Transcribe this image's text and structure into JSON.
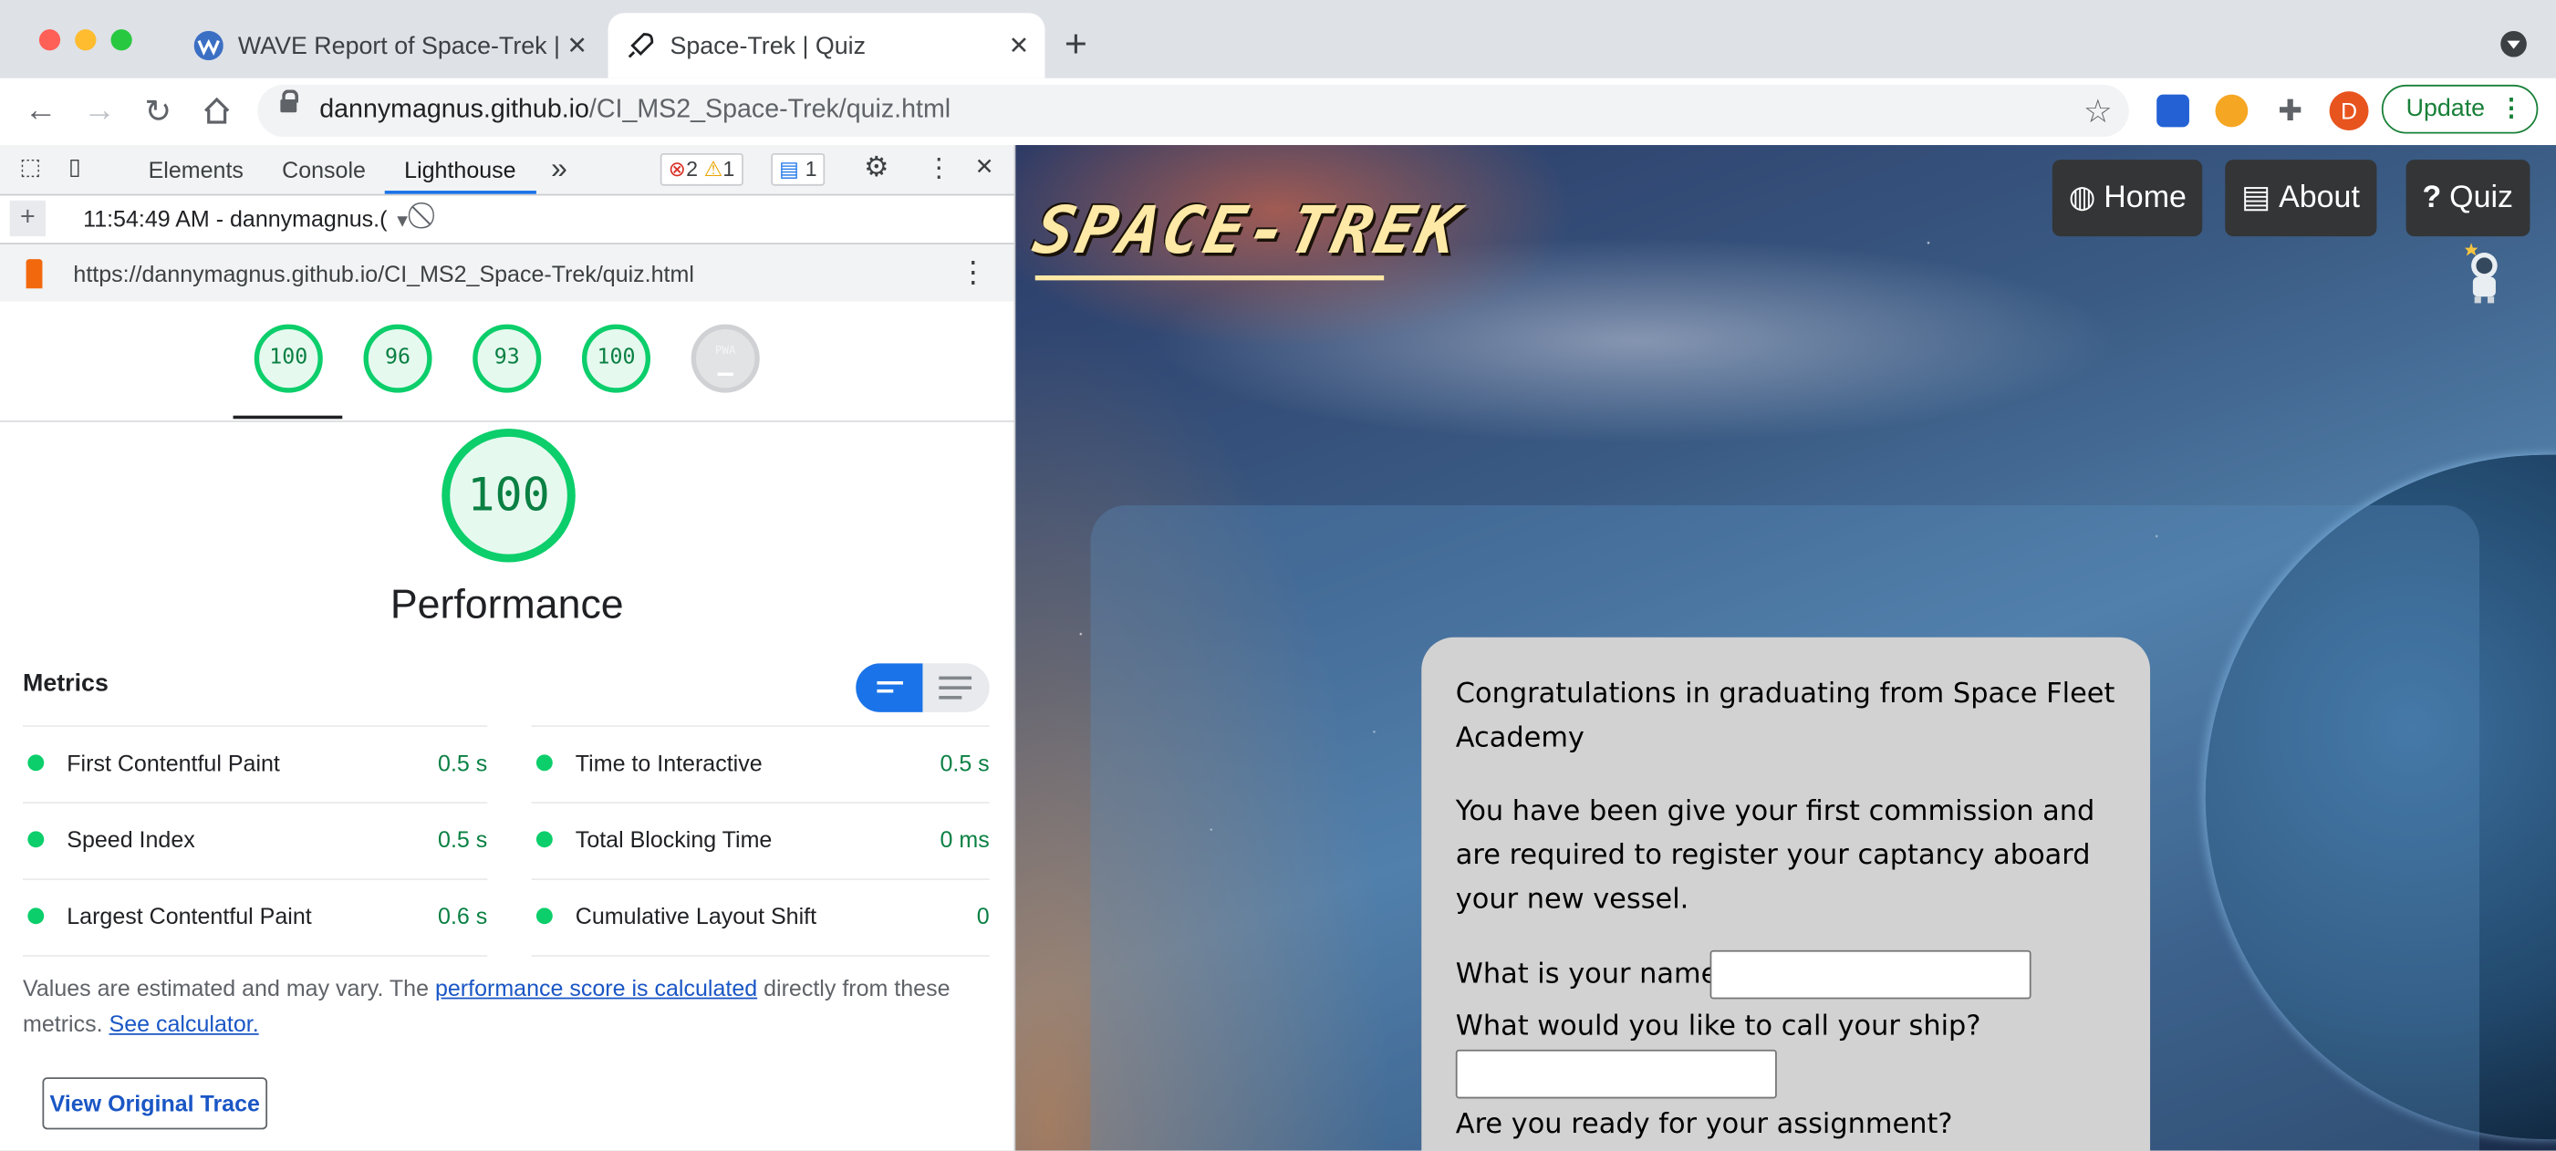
{
  "browser": {
    "tabs": [
      {
        "title": "WAVE Report of Space-Trek | C",
        "active": false
      },
      {
        "title": "Space-Trek | Quiz",
        "active": true
      }
    ],
    "url_host": "dannymagnus.github.io",
    "url_path": "/CI_MS2_Space-Trek/quiz.html",
    "profile_initial": "D",
    "update_label": "Update"
  },
  "devtools": {
    "tabs": [
      "Elements",
      "Console",
      "Lighthouse"
    ],
    "active_tab": "Lighthouse",
    "more": "»",
    "errors": "2",
    "warnings": "1",
    "messages": "1",
    "report_time": "11:54:49 AM - dannymagnus.(",
    "report_url": "https://dannymagnus.github.io/CI_MS2_Space-Trek/quiz.html",
    "scores": [
      "100",
      "96",
      "93",
      "100"
    ],
    "pwa_label": "PWA",
    "pwa_score": "–",
    "main_score": "100",
    "category": "Performance",
    "metrics_heading": "Metrics",
    "metrics": [
      {
        "label": "First Contentful Paint",
        "value": "0.5 s"
      },
      {
        "label": "Time to Interactive",
        "value": "0.5 s"
      },
      {
        "label": "Speed Index",
        "value": "0.5 s"
      },
      {
        "label": "Total Blocking Time",
        "value": "0 ms"
      },
      {
        "label": "Largest Contentful Paint",
        "value": "0.6 s"
      },
      {
        "label": "Cumulative Layout Shift",
        "value": "0"
      }
    ],
    "note_pre": "Values are estimated and may vary. The ",
    "note_link": "performance score is calculated",
    "note_mid": " directly from these metrics. ",
    "note_link2": "See calculator.",
    "trace_button": "View Original Trace",
    "colors": {
      "pass": "#0cce6b",
      "pass_text": "#0a8043",
      "accent": "#1a73e8"
    }
  },
  "site": {
    "logo": "SPACE-TREK",
    "nav": [
      {
        "label": "Home",
        "icon": "globe-icon"
      },
      {
        "label": "About",
        "icon": "id-card-icon"
      },
      {
        "label": "Quiz",
        "icon": "question-icon"
      }
    ],
    "quiz": {
      "intro": "Congratulations in graduating from Space Fleet Academy",
      "instructions": "You have been give your first commission and are required to register your captancy aboard your new vessel.",
      "q_name": "What is your name?",
      "q_ship": "What would you like to call your ship?",
      "q_ready": "Are you ready for your assignment?"
    }
  }
}
